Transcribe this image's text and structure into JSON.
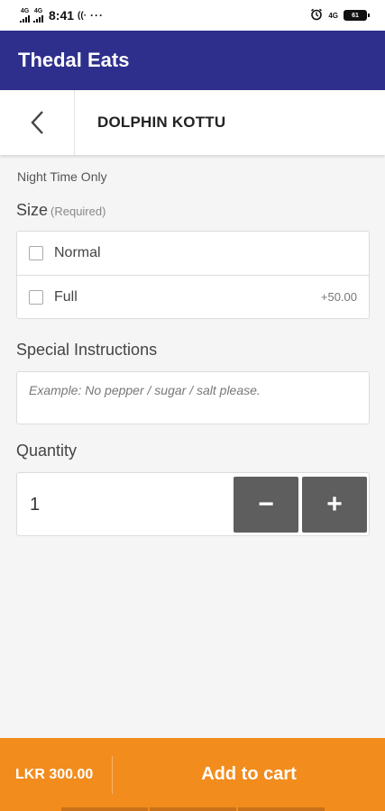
{
  "status_bar": {
    "net1": "4G",
    "net2": "4G",
    "time": "8:41",
    "overflow": "···",
    "net_right": "4G",
    "battery": "61",
    "icons": [
      "signal-icon",
      "wifi-calling-icon",
      "alarm-icon",
      "battery-icon"
    ]
  },
  "app": {
    "title": "Thedal Eats",
    "brand_color": "#2e2f8c"
  },
  "item": {
    "title": "DOLPHIN KOTTU",
    "back_icon": "chevron-left-icon"
  },
  "note": "Night Time Only",
  "size": {
    "label": "Size",
    "required": "(Required)",
    "options": [
      {
        "label": "Normal",
        "price": "",
        "checked": false
      },
      {
        "label": "Full",
        "price": "+50.00",
        "checked": false
      }
    ]
  },
  "instructions": {
    "label": "Special Instructions",
    "placeholder": "Example: No pepper / sugar / salt please.",
    "value": ""
  },
  "quantity": {
    "label": "Quantity",
    "value": "1",
    "minus": "−",
    "plus": "+"
  },
  "footer": {
    "price": "LKR 300.00",
    "add_to_cart": "Add to cart",
    "accent": "#f28c1d"
  }
}
